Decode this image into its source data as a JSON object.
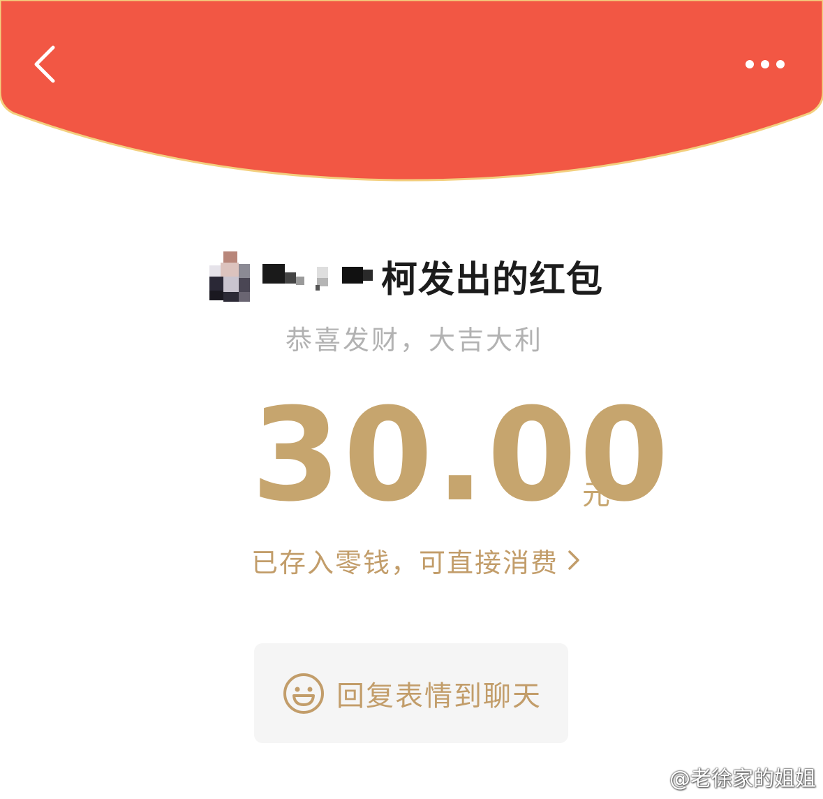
{
  "header": {
    "background_color": "#f25744",
    "border_color": "#f3cf7e",
    "back_icon": "chevron-left-icon",
    "more_icon": "more-dots-icon"
  },
  "sender": {
    "name_masked": true,
    "title_suffix": "柯发出的红包"
  },
  "greeting": "恭喜发财，大吉大利",
  "amount": {
    "value": "30.00",
    "unit": "元",
    "color": "#c6a56e"
  },
  "change_link": {
    "label": "已存入零钱，可直接消费",
    "icon": "chevron-right-icon"
  },
  "reply_button": {
    "label": "回复表情到聊天",
    "icon": "smile-icon"
  },
  "watermark": {
    "text": "@老徐家的姐姐",
    "icon": "weibo-icon"
  }
}
